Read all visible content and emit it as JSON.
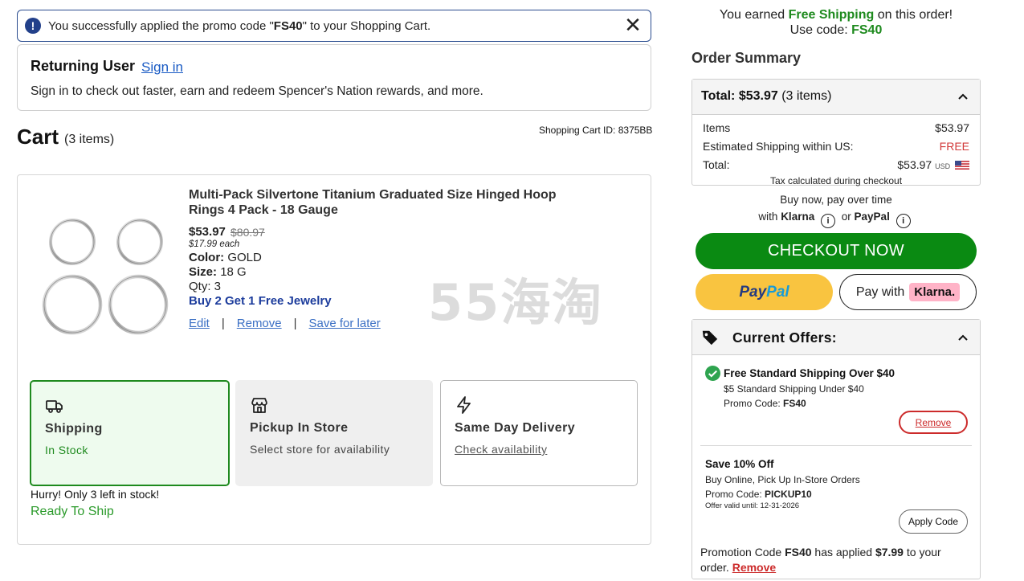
{
  "alert": {
    "message_prefix": "You successfully applied the promo code \"",
    "code": "FS40",
    "message_suffix": "\" to your Shopping Cart.",
    "close_symbol": "✕"
  },
  "returning_user": {
    "title": "Returning User",
    "sign_in": "Sign in",
    "description": "Sign in to check out faster, earn and redeem Spencer's Nation rewards, and more."
  },
  "cart": {
    "title": "Cart",
    "count": "(3 items)",
    "cart_id": "Shopping Cart ID: 8375BB"
  },
  "item": {
    "name": "Multi-Pack Silvertone Titanium Graduated Size Hinged Hoop Rings 4 Pack - 18 Gauge",
    "price": "$53.97",
    "old_price": "$80.97",
    "each": "$17.99 each",
    "color_label": "Color:",
    "color_value": "GOLD",
    "size_label": "Size:",
    "size_value": "18 G",
    "qty": "Qty: 3",
    "promo": "Buy 2 Get 1 Free Jewelry",
    "edit": "Edit",
    "remove": "Remove",
    "save_for_later": "Save for later",
    "separator": "|"
  },
  "watermark": "55海淘",
  "fulfillment": {
    "shipping": {
      "title": "Shipping",
      "sub": "In Stock",
      "icon": "truck-icon"
    },
    "pickup": {
      "title": "Pickup In Store",
      "sub": "Select store for availability",
      "icon": "store-icon"
    },
    "same_day": {
      "title": "Same Day Delivery",
      "sub": "Check availability",
      "icon": "lightning-icon"
    }
  },
  "stock": {
    "hurry": "Hurry! Only 3 left in stock!",
    "ready": "Ready To Ship"
  },
  "earned": {
    "prefix": "You earned ",
    "highlight": "Free Shipping",
    "suffix": " on this order!",
    "code_label": "Use code: ",
    "code": "FS40"
  },
  "summary": {
    "title": "Order Summary",
    "total_label": "Total:",
    "total_value": "$53.97",
    "total_items": "(3 items)",
    "rows": [
      {
        "label": "Items",
        "value": "$53.97"
      },
      {
        "label": "Estimated Shipping within US:",
        "value": "FREE"
      },
      {
        "label": "Total:",
        "value": "$53.97",
        "currency": "USD"
      }
    ],
    "tax_note": "Tax calculated during checkout"
  },
  "pay_later": {
    "line1": "Buy now, pay over time",
    "with": "with",
    "klarna": "Klarna",
    "or": "or",
    "paypal": "PayPal",
    "info_symbol": "i"
  },
  "buttons": {
    "checkout": "CHECKOUT NOW",
    "paypal_a": "Pay",
    "paypal_b": "Pal",
    "pay_with": "Pay with",
    "klarna": "Klarna."
  },
  "offers": {
    "title": "Current Offers:",
    "offer1": {
      "title": "Free Standard Shipping Over $40",
      "line1": "$5 Standard Shipping Under $40",
      "code_label": "Promo Code: ",
      "code": "FS40",
      "button": "Remove"
    },
    "offer2": {
      "title": "Save 10% Off",
      "line1": "Buy Online, Pick Up In-Store Orders",
      "code_label": "Promo Code: ",
      "code": "PICKUP10",
      "valid": "Offer valid until: 12-31-2026",
      "button": "Apply Code"
    },
    "applied": {
      "prefix": "Promotion Code ",
      "code": "FS40",
      "middle": " has applied ",
      "amount": "$7.99",
      "suffix": " to your order. ",
      "remove": "Remove"
    }
  },
  "colors": {
    "accent_green": "#0a8a12",
    "link_blue": "#1a5bc4",
    "alert_border": "#2a4c8f",
    "red": "#cc2b2b",
    "paypal_yellow": "#f9c440",
    "klarna_pink": "#ffb3c7"
  }
}
